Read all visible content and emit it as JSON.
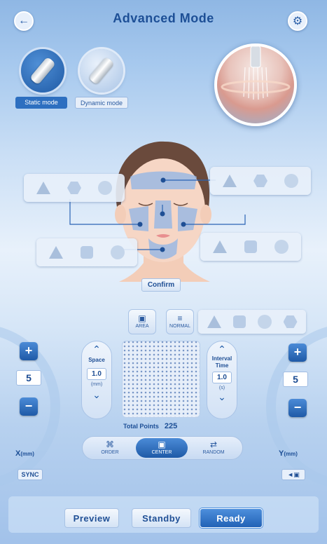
{
  "header": {
    "title": "Advanced Mode",
    "back_icon": "arrow-left-icon",
    "settings_icon": "gear-icon"
  },
  "mode": {
    "static_label": "Static mode",
    "dynamic_label": "Dynamic mode",
    "selected": "Static mode"
  },
  "face": {
    "confirm_label": "Confirm"
  },
  "controls": {
    "area_label": "AREA",
    "normal_label": "NORMAL",
    "x": {
      "value": "5",
      "label": "X",
      "unit": "(mm)"
    },
    "y": {
      "value": "5",
      "label": "Y",
      "unit": "(mm)"
    },
    "space": {
      "title": "Space",
      "value": "1.0",
      "unit": "(mm)"
    },
    "interval": {
      "title_line1": "Interval",
      "title_line2": "Time",
      "value": "1.0",
      "unit": "(s)"
    },
    "total_label": "Total Points",
    "total_value": "225",
    "order_label": "ORDER",
    "center_label": "CENTER",
    "random_label": "RANDOM",
    "sync_label": "SYNC"
  },
  "footer": {
    "preview_label": "Preview",
    "standby_label": "Standby",
    "ready_label": "Ready",
    "active": "Ready"
  },
  "colors": {
    "accent": "#2262b6",
    "title": "#1d4f96",
    "panel": "#e8f0fb"
  }
}
